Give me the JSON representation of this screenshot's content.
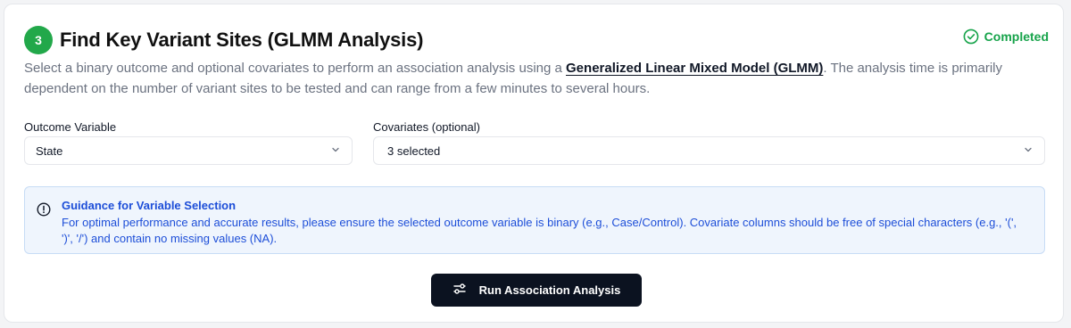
{
  "step": {
    "number": "3",
    "title": "Find Key Variant Sites (GLMM Analysis)",
    "status": "Completed",
    "status_color": "#16a34a",
    "badge_color": "#22a84a"
  },
  "description": {
    "before_link": "Select a binary outcome and optional covariates to perform an association analysis using a ",
    "link_text": "Generalized Linear Mixed Model (GLMM)",
    "after_link": ". The analysis time is primarily dependent on the number of variant sites to be tested and can range from a few minutes to several hours."
  },
  "outcome": {
    "label": "Outcome Variable",
    "value": "State"
  },
  "covariates": {
    "label": "Covariates (optional)",
    "value": "3 selected"
  },
  "guidance": {
    "title": "Guidance for Variable Selection",
    "text": "For optimal performance and accurate results, please ensure the selected outcome variable is binary (e.g., Case/Control). Covariate columns should be free of special characters (e.g., '(', ')', '/') and contain no missing values (NA).",
    "color": "#1d4ed8"
  },
  "run_button": {
    "label": "Run Association Analysis",
    "icon": "sliders-icon"
  },
  "icons": {
    "status": "check-circle-icon",
    "dropdown": "chevron-down-icon",
    "guidance": "alert-circle-icon"
  }
}
